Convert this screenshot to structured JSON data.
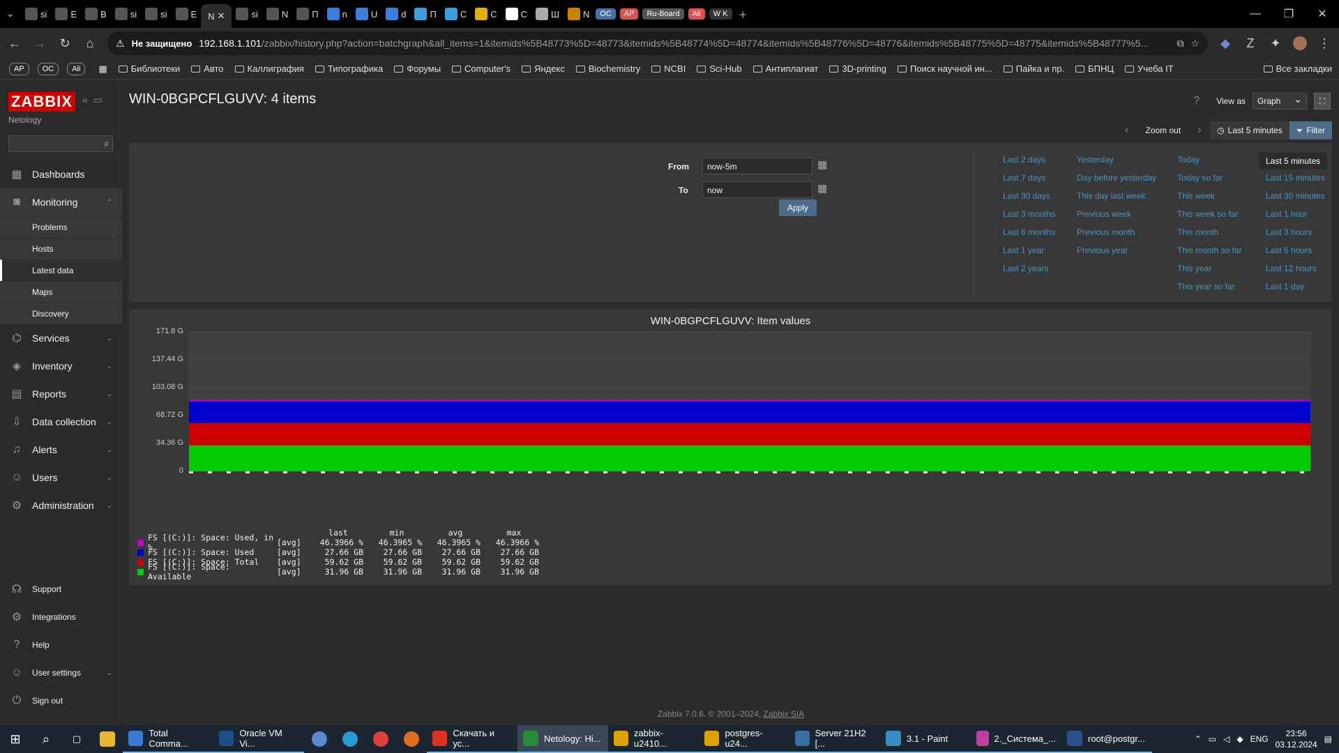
{
  "browser": {
    "tabs": [
      {
        "label": "si",
        "color": "#555"
      },
      {
        "label": "E",
        "color": "#555"
      },
      {
        "label": "B",
        "color": "#555"
      },
      {
        "label": "si",
        "color": "#555"
      },
      {
        "label": "si",
        "color": "#555"
      },
      {
        "label": "E",
        "color": "#555"
      },
      {
        "label": "si",
        "color": "#555"
      },
      {
        "label": "N",
        "color": "#555"
      },
      {
        "label": "П",
        "color": "#555"
      },
      {
        "label": "n",
        "color": "#3b7ddd"
      },
      {
        "label": "U",
        "color": "#3b7ddd"
      },
      {
        "label": "d",
        "color": "#3b7ddd"
      },
      {
        "label": "П",
        "color": "#3b9ddd"
      },
      {
        "label": "C",
        "color": "#3b9ddd"
      },
      {
        "label": "C",
        "color": "#e0b000"
      },
      {
        "label": "C",
        "color": "#ffffff"
      },
      {
        "label": "Ш",
        "color": "#aaa"
      },
      {
        "label": "N",
        "color": "#d08000"
      }
    ],
    "active_tab": {
      "label": "N"
    },
    "badges": [
      {
        "label": "OC",
        "color": "#4a6fa5"
      },
      {
        "label": "AP",
        "color": "#d9534f"
      },
      {
        "label": "Ru-Board",
        "color": "#555"
      },
      {
        "label": "Ali",
        "color": "#e05050"
      },
      {
        "label": "W K",
        "color": "#333"
      }
    ],
    "insecure_label": "Не защищено",
    "url_host": "192.168.1.101",
    "url_path": "/zabbix/history.php?action=batchgraph&all_items=1&itemids%5B48773%5D=48773&itemids%5B48774%5D=48774&itemids%5B48776%5D=48776&itemids%5B48775%5D=48775&itemids%5B48777%5...",
    "bookmarks_lead": [
      "AP",
      "OC",
      "Ali"
    ],
    "bookmarks": [
      "Библиотеки",
      "Авто",
      "Каллиграфия",
      "Типографика",
      "Форумы",
      "Computer's",
      "Яндекс",
      "Biochemistry",
      "NCBI",
      "Sci-Hub",
      "Антиплагиат",
      "3D-printing",
      "Поиск научной ин...",
      "Пайка и пр.",
      "БПНЦ",
      "Учеба IT"
    ],
    "all_bookmarks": "Все закладки"
  },
  "sidebar": {
    "logo": "ZABBIX",
    "server_name": "Netology",
    "nav": [
      {
        "label": "Dashboards",
        "icon": "dashboard-icon",
        "glyph": "▦"
      },
      {
        "label": "Monitoring",
        "icon": "monitoring-icon",
        "glyph": "◙"
      }
    ],
    "monitoring_sub": [
      "Problems",
      "Hosts",
      "Latest data",
      "Maps",
      "Discovery"
    ],
    "nav2": [
      {
        "label": "Services",
        "icon": "services-icon",
        "glyph": "⌬"
      },
      {
        "label": "Inventory",
        "icon": "inventory-icon",
        "glyph": "◈"
      },
      {
        "label": "Reports",
        "icon": "reports-icon",
        "glyph": "▤"
      },
      {
        "label": "Data collection",
        "icon": "data-collection-icon",
        "glyph": "⇩"
      },
      {
        "label": "Alerts",
        "icon": "alerts-icon",
        "glyph": "♫"
      },
      {
        "label": "Users",
        "icon": "users-icon",
        "glyph": "☺"
      },
      {
        "label": "Administration",
        "icon": "administration-icon",
        "glyph": "⚙"
      }
    ],
    "bottom": [
      {
        "label": "Support",
        "icon": "support-icon",
        "glyph": "☊"
      },
      {
        "label": "Integrations",
        "icon": "integrations-icon",
        "glyph": "⚙"
      },
      {
        "label": "Help",
        "icon": "help-icon",
        "glyph": "?"
      },
      {
        "label": "User settings",
        "icon": "user-settings-icon",
        "glyph": "☺"
      },
      {
        "label": "Sign out",
        "icon": "sign-out-icon",
        "glyph": "⏻"
      }
    ]
  },
  "main": {
    "title": "WIN-0BGPCFLGUVV: 4 items",
    "view_as_label": "View as",
    "view_as_value": "Graph",
    "zoom_out": "Zoom out",
    "time_range": "Last 5 minutes",
    "filter_label": "Filter",
    "from_label": "From",
    "from_value": "now-5m",
    "to_label": "To",
    "to_value": "now",
    "apply_label": "Apply",
    "quick_ranges": [
      [
        "Last 2 days",
        "Last 7 days",
        "Last 30 days",
        "Last 3 months",
        "Last 6 months",
        "Last 1 year",
        "Last 2 years"
      ],
      [
        "Yesterday",
        "Day before yesterday",
        "This day last week",
        "Previous week",
        "Previous month",
        "Previous year"
      ],
      [
        "Today",
        "Today so far",
        "This week",
        "This week so far",
        "This month",
        "This month so far",
        "This year",
        "This year so far"
      ],
      [
        "Last 5 minutes",
        "Last 15 minutes",
        "Last 30 minutes",
        "Last 1 hour",
        "Last 3 hours",
        "Last 6 hours",
        "Last 12 hours",
        "Last 1 day"
      ]
    ],
    "selected_quick": "Last 5 minutes"
  },
  "chart_data": {
    "type": "area",
    "title": "WIN-0BGPCFLGUVV: Item values",
    "ylim": [
      0,
      171.8
    ],
    "y_ticks": [
      "0",
      "34.36 G",
      "68.72 G",
      "103.08 G",
      "137.44 G",
      "171.8 G"
    ],
    "series": [
      {
        "name": "FS [(C:)]: Space: Used, in %",
        "func": "[avg]",
        "color": "#cc00cc",
        "last": "46.3966 %",
        "min": "46.3965 %",
        "avg": "46.3965 %",
        "max": "46.3966 %",
        "value": 46.3966
      },
      {
        "name": "FS [(C:)]: Space: Used",
        "func": "[avg]",
        "color": "#0000cc",
        "last": "27.66 GB",
        "min": "27.66 GB",
        "avg": "27.66 GB",
        "max": "27.66 GB",
        "value": 27.66
      },
      {
        "name": "FS [(C:)]: Space: Total",
        "func": "[avg]",
        "color": "#cc0000",
        "last": "59.62 GB",
        "min": "59.62 GB",
        "avg": "59.62 GB",
        "max": "59.62 GB",
        "value": 59.62
      },
      {
        "name": "FS [(C:)]: Space: Available",
        "func": "[avg]",
        "color": "#00cc00",
        "last": "31.96 GB",
        "min": "31.96 GB",
        "avg": "31.96 GB",
        "max": "31.96 GB",
        "value": 31.96
      }
    ],
    "legend_headers": [
      "last",
      "min",
      "avg",
      "max"
    ]
  },
  "footer": {
    "text": "Zabbix 7.0.6. © 2001–2024,",
    "link": "Zabbix SIA"
  },
  "taskbar": {
    "apps": [
      {
        "label": "Total Comma...",
        "color": "#3a7bd5"
      },
      {
        "label": "Oracle VM Vi...",
        "color": "#1c4f8a"
      },
      {
        "label": "Скачать и ус...",
        "color": "#e0301e"
      },
      {
        "label": "Netology: Hi...",
        "color": "#2a8a3a"
      },
      {
        "label": "zabbix-u2410...",
        "color": "#e0a000"
      },
      {
        "label": "postgres-u24...",
        "color": "#e0a000"
      },
      {
        "label": "Server 21H2 [...",
        "color": "#3a6fa5"
      },
      {
        "label": "3.1 - Paint",
        "color": "#3a8ac4"
      },
      {
        "label": "2._Система_...",
        "color": "#c040a0"
      },
      {
        "label": "root@postgr...",
        "color": "#2a4f8a"
      }
    ],
    "lang": "ENG",
    "time": "23:56",
    "date": "03.12.2024"
  }
}
